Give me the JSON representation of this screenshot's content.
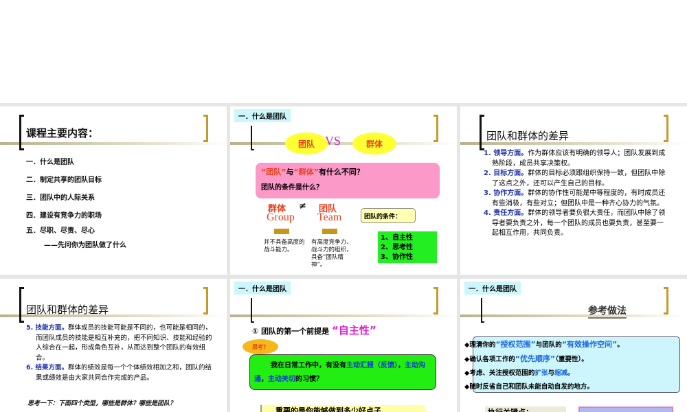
{
  "slide1": {
    "title": "课程主要内容：",
    "items": [
      "一．什么是团队",
      "二．制定共享的团队目标",
      "三．团队中的人际关系",
      "四．建设有竞争力的职场",
      "五．尽职、尽责、尽心",
      "——先问你为团队做了什么"
    ]
  },
  "slide2": {
    "tag": "一．什么是团队",
    "cloud_team": "团队",
    "vs": "VS",
    "cloud_group": "群体",
    "q1_a": "“团队”",
    "q1_b": "与",
    "q1_c": "“群体”",
    "q1_d": "有什么不同？",
    "q2": "团队的条件是什么？",
    "group_cn": "群体",
    "neq": "≠",
    "team_cn": "团队",
    "group_en": "Group",
    "team_en": "Team",
    "group_desc": "并不具备高度的战斗能力。",
    "team_desc": "有高度竞争力、战斗力的组织，具备“团队精神”。",
    "callout": "团队的条件：",
    "conditions": [
      "1、自主性",
      "2、思考性",
      "3、协作性"
    ]
  },
  "slide3": {
    "title": "团队和群体的差异",
    "items": [
      {
        "head": "1. 领导方面。",
        "body": "作为群体应该有明确的领导人；团队发展到成熟阶段，成员共享决策权。"
      },
      {
        "head": "2. 目标方面。",
        "body": "群体的目标必须跟组织保持一致，但团队中除了这点之外，还可以产生自己的目标。"
      },
      {
        "head": "3. 协作方面。",
        "body": "群体的协作性可能是中等程度的，有时成员还有些消极，有些对立；但团队中是一种齐心协力的气氛。"
      },
      {
        "head": "4. 责任方面。",
        "body": "群体的领导者要负很大责任，而团队中除了领导者要负责之外，每一个团队的成员也要负责，甚至要一起相互作用，共同负责。"
      }
    ]
  },
  "slide4": {
    "title": "团队和群体的差异",
    "items": [
      {
        "head": "5. 技能方面。",
        "body": "群体成员的技能可能是不同的，也可能是相同的，而团队成员的技能是相互补充的，把不同知识、技能和经验的人综合在一起，形成角色互补，从而达到整个团队的有效组合。"
      },
      {
        "head": "6. 结果方面。",
        "body": "群体的绩效是每一个个体绩效相加之和，团队的结果或绩效是由大家共同合作完成的产品。"
      }
    ],
    "think": "思考一下：下面四个类型，哪些是群体？哪些是团队？"
  },
  "slide5": {
    "tag": "一．什么是团队",
    "premise": "① 团队的第一个前提是",
    "premise_hl": "“自主性”",
    "bubble": "思考？",
    "q_a": "我在日常工作中，有没有",
    "q_b": "主动汇报（反馈）",
    "q_c": "，",
    "q_d": "主动沟通",
    "q_e": "，",
    "q_f": "主动关切",
    "q_g": "的习惯？",
    "bottom": "重要的是你能够做到多少好点子"
  },
  "slide6": {
    "tag": "一．什么是团队",
    "heading": "参考做法",
    "bullets": [
      [
        "理清你的",
        "“授权范围”",
        "与团队的",
        "“有效操作空间”",
        "。"
      ],
      [
        "确认各项工作的",
        "“优先顺序”",
        "（重要性）。",
        "",
        ""
      ],
      [
        "考虑、关注授权范围的",
        "扩张",
        "与",
        "缩减",
        "。"
      ],
      [
        "随时反省自己和团队未能自动自发的地方。",
        "",
        "",
        "",
        ""
      ]
    ],
    "key": "执行关键点："
  }
}
